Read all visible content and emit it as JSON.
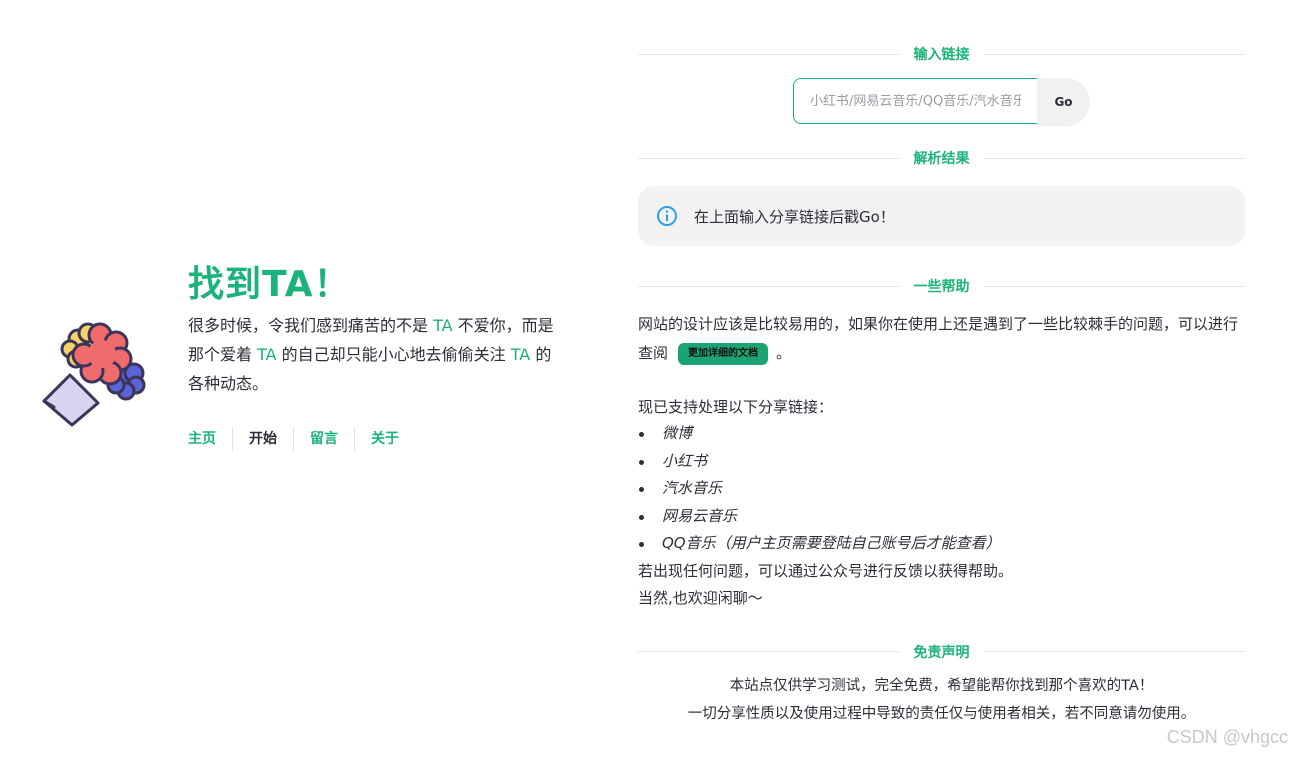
{
  "hero": {
    "title": "找到TA！",
    "desc_1": "很多时候，令我们感到痛苦的不是 ",
    "ta_1": "TA",
    "desc_2": " 不爱你，而是那个爱着 ",
    "ta_2": "TA",
    "desc_3": " 的自己却只能小心地去偷偷关注 ",
    "ta_3": "TA",
    "desc_4": " 的各种动态。",
    "nav": [
      {
        "label": "主页",
        "color": "#1bb37a"
      },
      {
        "label": "开始",
        "color": "#2d2d3a"
      },
      {
        "label": "留言",
        "color": "#1bb37a"
      },
      {
        "label": "关于",
        "color": "#1bb37a"
      }
    ],
    "icon": "flower-bouquet-icon"
  },
  "input_section": {
    "title": "输入链接",
    "placeholder": "小红书/网易云音乐/QQ音乐/汽水音乐分享链接",
    "go_label": "Go"
  },
  "result_section": {
    "title": "解析结果",
    "message": "在上面输入分享链接后戳Go！",
    "icon": "info-icon"
  },
  "help_section": {
    "title": "一些帮助",
    "text_1": "网站的设计应该是比较易用的，如果你在使用上还是遇到了一些比较棘手的问题，可以进行查阅",
    "doc_button": "更加详细的文档",
    "text_2": "。",
    "support_title": "现已支持处理以下分享链接：",
    "platforms": [
      "微博",
      "小红书",
      "汽水音乐",
      "网易云音乐",
      "QQ音乐（用户主页需要登陆自己账号后才能查看）"
    ],
    "feedback": "若出现任何问题，可以通过公众号进行反馈以获得帮助。",
    "chat": "当然,也欢迎闲聊～"
  },
  "disclaimer_section": {
    "title": "免责声明",
    "line_1": "本站点仅供学习测试，完全免费，希望能帮你找到那个喜欢的TA！",
    "line_2": "一切分享性质以及使用过程中导致的责任仅与使用者相关，若不同意请勿使用。"
  },
  "watermark": "CSDN @vhgcc",
  "colors": {
    "accent": "#1bb37a",
    "info": "#2aa3e0",
    "doc_button": "#1ba373"
  }
}
